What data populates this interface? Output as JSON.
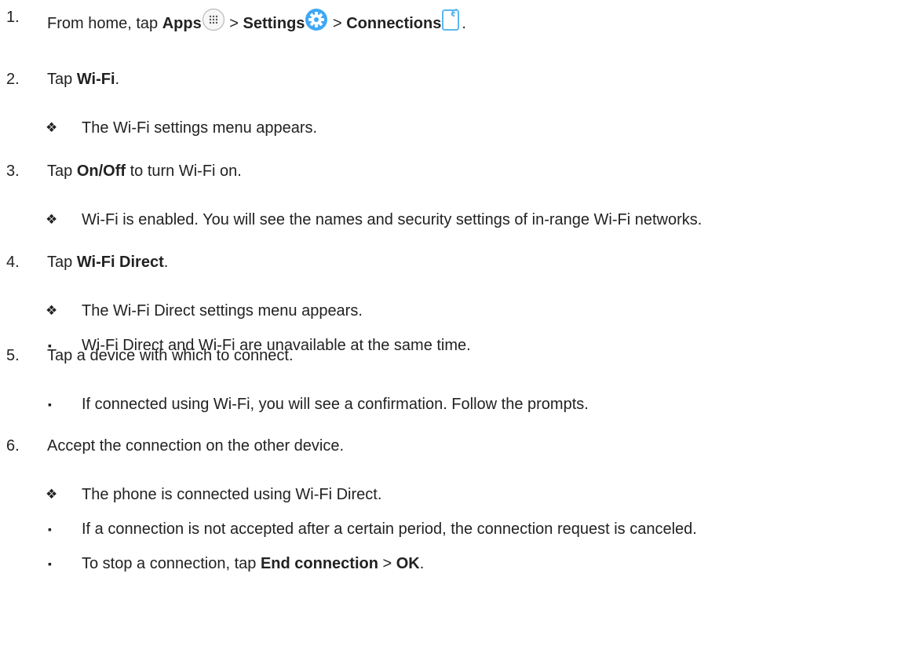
{
  "steps": [
    {
      "number": "1.",
      "parts": [
        {
          "t": "From home, tap "
        },
        {
          "b": "Apps"
        },
        {
          "icon": "apps-grid-icon"
        },
        {
          "t": " > "
        },
        {
          "b": "Settings"
        },
        {
          "icon": "settings-gear-icon"
        },
        {
          "t": " > "
        },
        {
          "b": "Connections"
        },
        {
          "icon": "connections-icon"
        },
        {
          "t": "."
        }
      ]
    },
    {
      "number": "2.",
      "parts": [
        {
          "t": "Tap "
        },
        {
          "b": "Wi-Fi"
        },
        {
          "t": "."
        }
      ],
      "subs": [
        {
          "marker": "diamond",
          "text": "The Wi-Fi settings menu appears."
        }
      ]
    },
    {
      "number": "3.",
      "parts": [
        {
          "t": "Tap "
        },
        {
          "b": "On/Off"
        },
        {
          "t": " to turn Wi-Fi on."
        }
      ],
      "subs": [
        {
          "marker": "diamond",
          "text": "Wi-Fi is enabled. You will see the names and security settings of in-range Wi-Fi networks."
        }
      ]
    },
    {
      "number": "4.",
      "parts": [
        {
          "t": "Tap "
        },
        {
          "b": "Wi-Fi Direct"
        },
        {
          "t": "."
        }
      ],
      "subs": [
        {
          "marker": "diamond",
          "text": "The Wi-Fi Direct settings menu appears."
        },
        {
          "marker": "square",
          "text": "Wi-Fi Direct and Wi-Fi are unavailable at the same time."
        }
      ]
    },
    {
      "number": "5.",
      "parts": [
        {
          "t": "Tap a device with which to connect."
        }
      ],
      "subs": [
        {
          "marker": "square",
          "text": "If connected using Wi-Fi, you will see a confirmation. Follow the prompts."
        }
      ]
    },
    {
      "number": "6.",
      "parts": [
        {
          "t": "Accept the connection on the other device."
        }
      ],
      "subs": [
        {
          "marker": "diamond",
          "text": "The phone is connected using Wi-Fi Direct."
        },
        {
          "marker": "square",
          "text": "If a connection is not accepted after a certain period, the connection request is canceled."
        },
        {
          "marker": "square",
          "parts": [
            {
              "t": "To stop a connection, tap "
            },
            {
              "b": "End connection"
            },
            {
              "t": " > "
            },
            {
              "b": "OK"
            },
            {
              "t": "."
            }
          ]
        }
      ]
    }
  ],
  "markers": {
    "diamond": "❖",
    "square": "▪"
  },
  "colors": {
    "text": "#222222",
    "settings_icon": "#3ea8f5",
    "connections_icon": "#5bb8f0",
    "apps_icon_border": "#bbbbbb"
  }
}
